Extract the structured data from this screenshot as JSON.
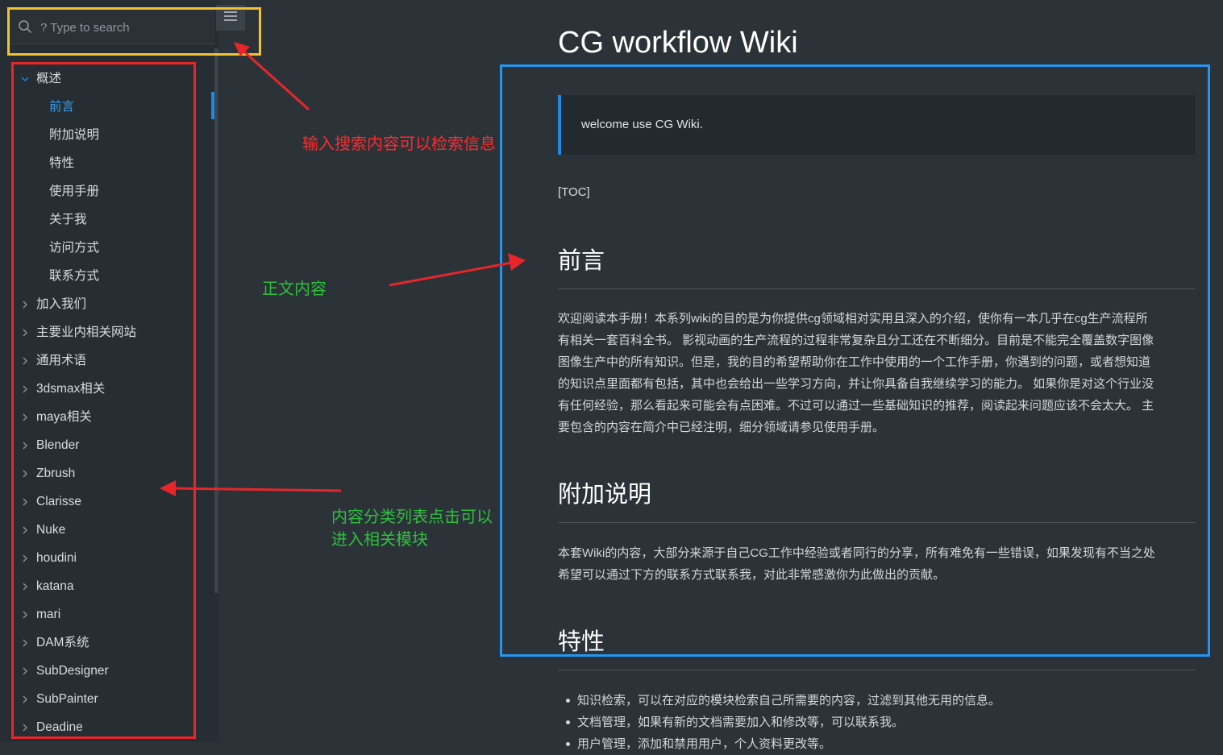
{
  "search": {
    "placeholder": "? Type to search"
  },
  "sidebar": {
    "items": [
      {
        "label": "概述",
        "level": 0,
        "expanded": true
      },
      {
        "label": "前言",
        "level": 1,
        "active": true
      },
      {
        "label": "附加说明",
        "level": 1
      },
      {
        "label": "特性",
        "level": 1
      },
      {
        "label": "使用手册",
        "level": 1
      },
      {
        "label": "关于我",
        "level": 1
      },
      {
        "label": "访问方式",
        "level": 1
      },
      {
        "label": "联系方式",
        "level": 1
      },
      {
        "label": "加入我们",
        "level": 0
      },
      {
        "label": "主要业内相关网站",
        "level": 0
      },
      {
        "label": "通用术语",
        "level": 0
      },
      {
        "label": "3dsmax相关",
        "level": 0
      },
      {
        "label": "maya相关",
        "level": 0
      },
      {
        "label": "Blender",
        "level": 0
      },
      {
        "label": "Zbrush",
        "level": 0
      },
      {
        "label": "Clarisse",
        "level": 0
      },
      {
        "label": "Nuke",
        "level": 0
      },
      {
        "label": "houdini",
        "level": 0
      },
      {
        "label": "katana",
        "level": 0
      },
      {
        "label": "mari",
        "level": 0
      },
      {
        "label": "DAM系统",
        "level": 0
      },
      {
        "label": "SubDesigner",
        "level": 0
      },
      {
        "label": "SubPainter",
        "level": 0
      },
      {
        "label": "Deadine",
        "level": 0
      }
    ]
  },
  "main": {
    "title": "CG workflow Wiki",
    "quote": "welcome use CG Wiki.",
    "toc": "[TOC]",
    "sections": {
      "preface": {
        "heading": "前言",
        "lines": [
          "欢迎阅读本手册！本系列wiki的目的是为你提供cg领域相对实用且深入的介绍，使你有一本几乎在cg生产流程所",
          "有相关一套百科全书。 影视动画的生产流程的过程非常复杂且分工还在不断细分。目前是不能完全覆盖数字图像",
          "图像生产中的所有知识。但是，我的目的希望帮助你在工作中使用的一个工作手册，你遇到的问题，或者想知道",
          "的知识点里面都有包括，其中也会给出一些学习方向，并让你具备自我继续学习的能力。 如果你是对这个行业没",
          "有任何经验，那么看起来可能会有点困难。不过可以通过一些基础知识的推荐，阅读起来问题应该不会太大。 主",
          "要包含的内容在简介中已经注明，细分领域请参见使用手册。"
        ]
      },
      "notes": {
        "heading": "附加说明",
        "lines": [
          "本套Wiki的内容，大部分来源于自己CG工作中经验或者同行的分享，所有难免有一些错误，如果发现有不当之处",
          "希望可以通过下方的联系方式联系我，对此非常感激你为此做出的贡献。"
        ]
      },
      "features": {
        "heading": "特性",
        "items": [
          "知识检索，可以在对应的模块检索自己所需要的内容，过滤到其他无用的信息。",
          "文档管理，如果有新的文档需要加入和修改等，可以联系我。",
          "用户管理，添加和禁用用户，个人资料更改等。"
        ]
      }
    }
  },
  "annotations": {
    "search_note": "输入搜索内容可以检索信息",
    "content_note": "正文内容",
    "nav_note_line1": "内容分类列表点击可以",
    "nav_note_line2": "进入相关模块"
  },
  "colors": {
    "background": "#2b3339",
    "sidebar_bg": "#262d33",
    "accent": "#1e88e5",
    "search_box_outline": "#f2c230",
    "nav_outline": "#e8262a",
    "content_outline": "#2196f3",
    "annotation_red": "#ff2a2a",
    "annotation_green": "#2fbf3c"
  }
}
